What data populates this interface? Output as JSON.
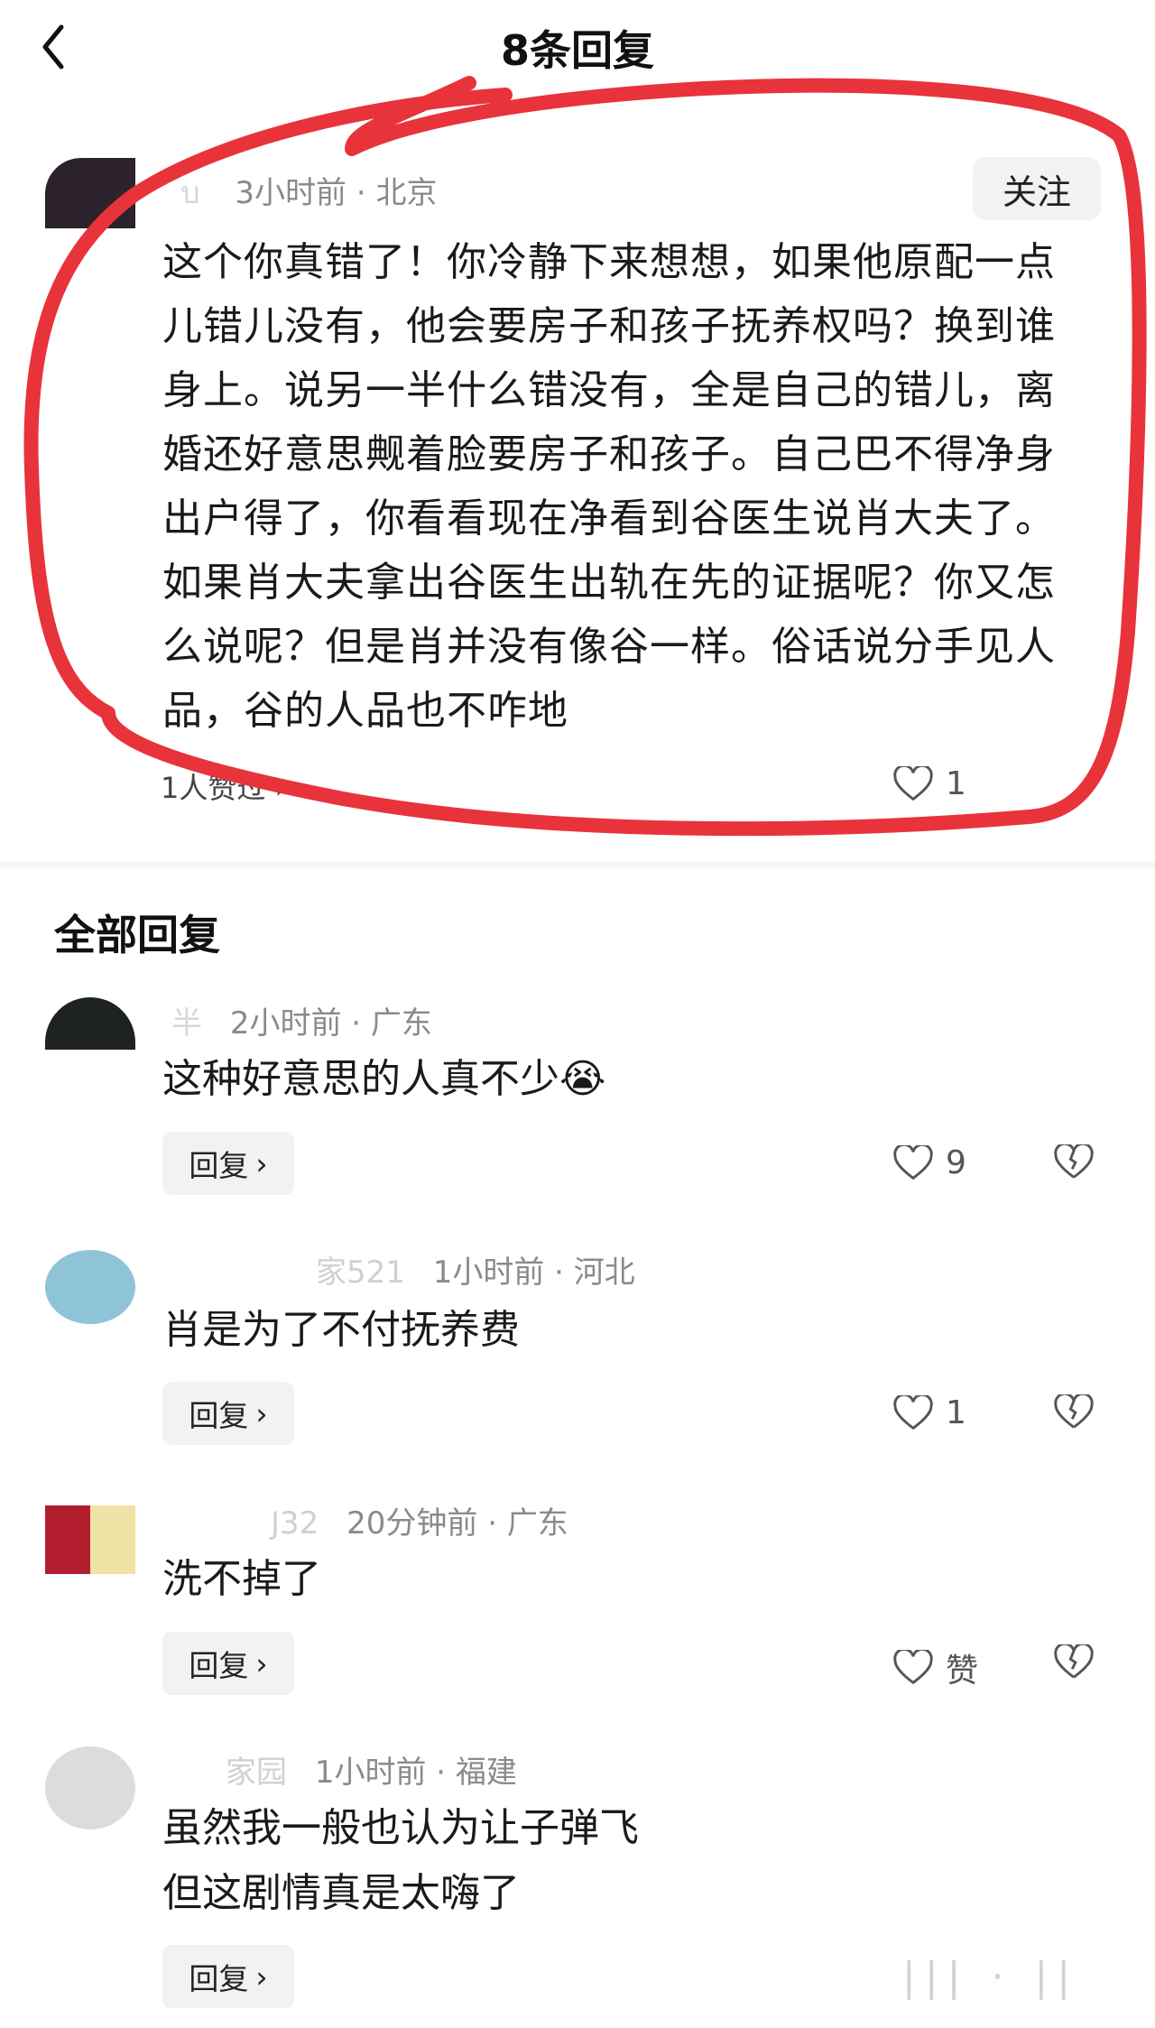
{
  "header": {
    "title": "8条回复",
    "back_icon": "chevron-left-icon"
  },
  "post": {
    "author_partial": "บ",
    "time": "3小时前",
    "location": "北京",
    "follow_label": "关注",
    "text": "这个你真错了！你冷静下来想想，如果他原配一点儿错儿没有，他会要房子和孩子抚养权吗？换到谁身上。说另一半什么错没有，全是自己的错儿，离婚还好意思觍着脸要房子和孩子。自己巴不得净身出户得了，你看看现在净看到谷医生说肖大夫了。如果肖大夫拿出谷医生出轨在先的证据呢？你又怎么说呢？但是肖并没有像谷一样。俗话说分手见人品，谷的人品也不咋地",
    "replies_summary": "1人赞过 ›",
    "likes": "1"
  },
  "replies_section": {
    "title": "全部回复"
  },
  "comments": [
    {
      "author_partial": "半",
      "time": "2小时前",
      "location": "广东",
      "text": "这种好意思的人真不少😭",
      "reply_label": "回复",
      "likes": "9"
    },
    {
      "author_partial": "家521",
      "time": "1小时前",
      "location": "河北",
      "text": "肖是为了不付抚养费",
      "reply_label": "回复",
      "likes": "1"
    },
    {
      "author_partial": "J32",
      "time": "20分钟前",
      "location": "广东",
      "text": "洗不掉了",
      "reply_label": "回复",
      "likes": "赞"
    },
    {
      "author_partial": "家园",
      "time": "1小时前",
      "location": "福建",
      "text_line1": "虽然我一般也认为让子弹飞",
      "text_line2": "但这剧情真是太嗨了",
      "reply_label": "回复"
    }
  ],
  "watermark": "|||  ·  ||",
  "colors": {
    "annotation": "#e8333b",
    "button_bg": "#f2f2f2",
    "meta": "#8a8a8a"
  }
}
